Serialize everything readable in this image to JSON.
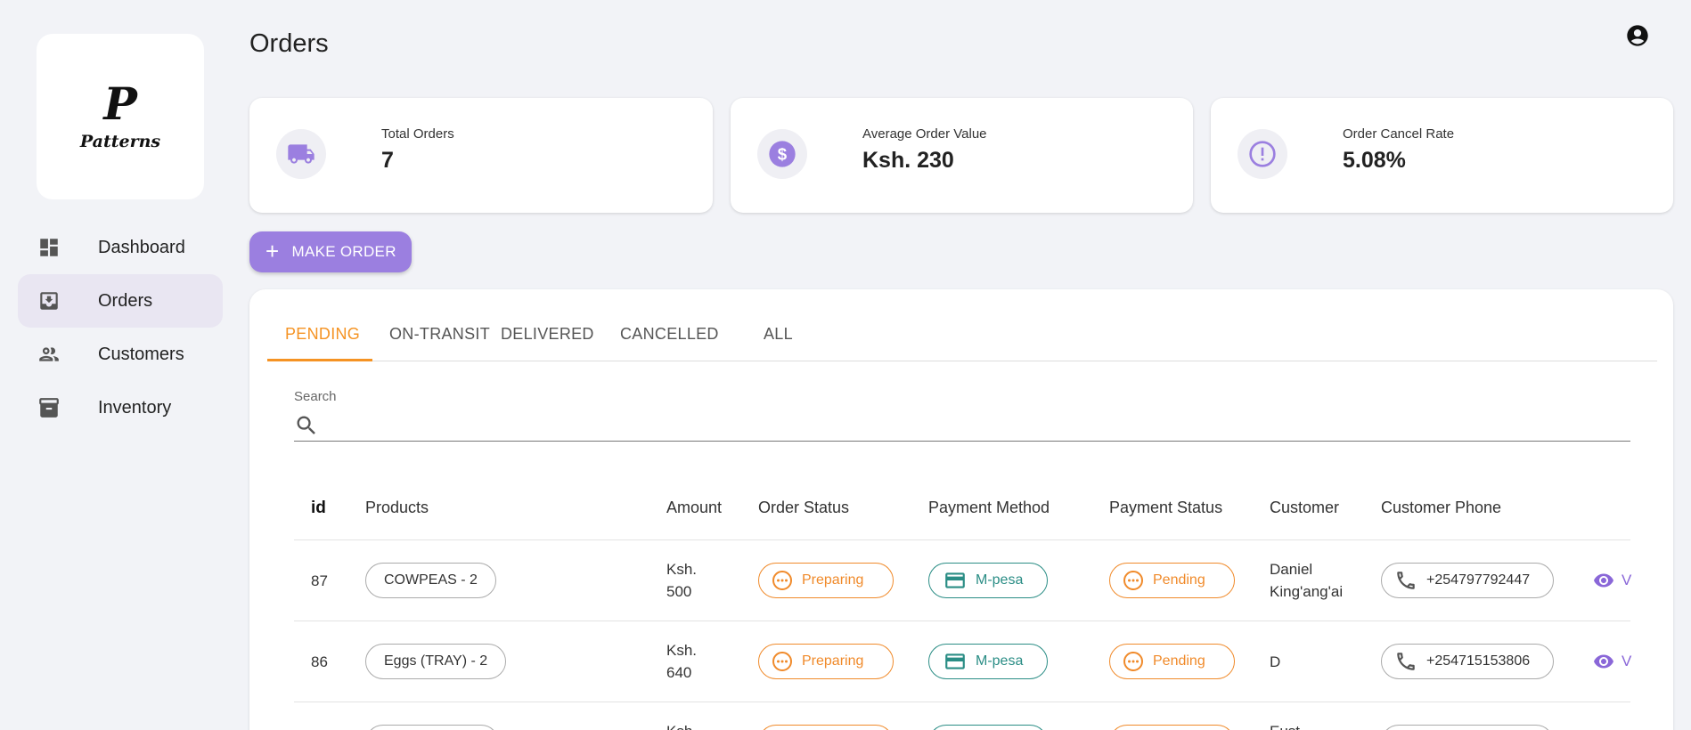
{
  "brand": {
    "logo_letter": "P",
    "logo_text": "Patterns"
  },
  "sidebar": {
    "items": [
      {
        "label": "Dashboard",
        "icon": "dashboard-icon",
        "active": false
      },
      {
        "label": "Orders",
        "icon": "orders-icon",
        "active": true
      },
      {
        "label": "Customers",
        "icon": "customers-icon",
        "active": false
      },
      {
        "label": "Inventory",
        "icon": "inventory-icon",
        "active": false
      }
    ]
  },
  "header": {
    "title": "Orders",
    "account_icon": "account-circle-icon"
  },
  "stats": [
    {
      "label": "Total Orders",
      "value": "7",
      "icon": "truck-icon"
    },
    {
      "label": "Average Order Value",
      "value": "Ksh. 230",
      "icon": "dollar-icon"
    },
    {
      "label": "Order Cancel Rate",
      "value": "5.08%",
      "icon": "alert-icon"
    }
  ],
  "actions": {
    "make_order": "MAKE ORDER"
  },
  "tabs": [
    "PENDING",
    "ON-TRANSIT",
    "DELIVERED",
    "CANCELLED",
    "ALL"
  ],
  "search": {
    "label": "Search",
    "value": ""
  },
  "table": {
    "columns": [
      "id",
      "Products",
      "Amount",
      "Order Status",
      "Payment Method",
      "Payment Status",
      "Customer",
      "Customer Phone"
    ],
    "rows": [
      {
        "id": "87",
        "product": "COWPEAS - 2",
        "amount_line1": "Ksh.",
        "amount_line2": "500",
        "order_status": "Preparing",
        "payment_method": "M-pesa",
        "payment_status": "Pending",
        "customer_line1": "Daniel",
        "customer_line2": "King'ang'ai",
        "phone": "+254797792447",
        "view": "V"
      },
      {
        "id": "86",
        "product": "Eggs (TRAY) - 2",
        "amount_line1": "Ksh.",
        "amount_line2": "640",
        "order_status": "Preparing",
        "payment_method": "M-pesa",
        "payment_status": "Pending",
        "customer_line1": "D",
        "customer_line2": "",
        "phone": "+254715153806",
        "view": "V"
      },
      {
        "id": "",
        "product": "",
        "amount_line1": "Ksh.",
        "amount_line2": "",
        "order_status": "",
        "payment_method": "",
        "payment_status": "",
        "customer_line1": "Eust",
        "customer_line2": "",
        "phone": "",
        "view": ""
      }
    ]
  },
  "colors": {
    "accent": "#9b7fe0",
    "tab_active": "#f59323",
    "status_orange": "#f08a2a",
    "payment_teal": "#2a8d85"
  }
}
